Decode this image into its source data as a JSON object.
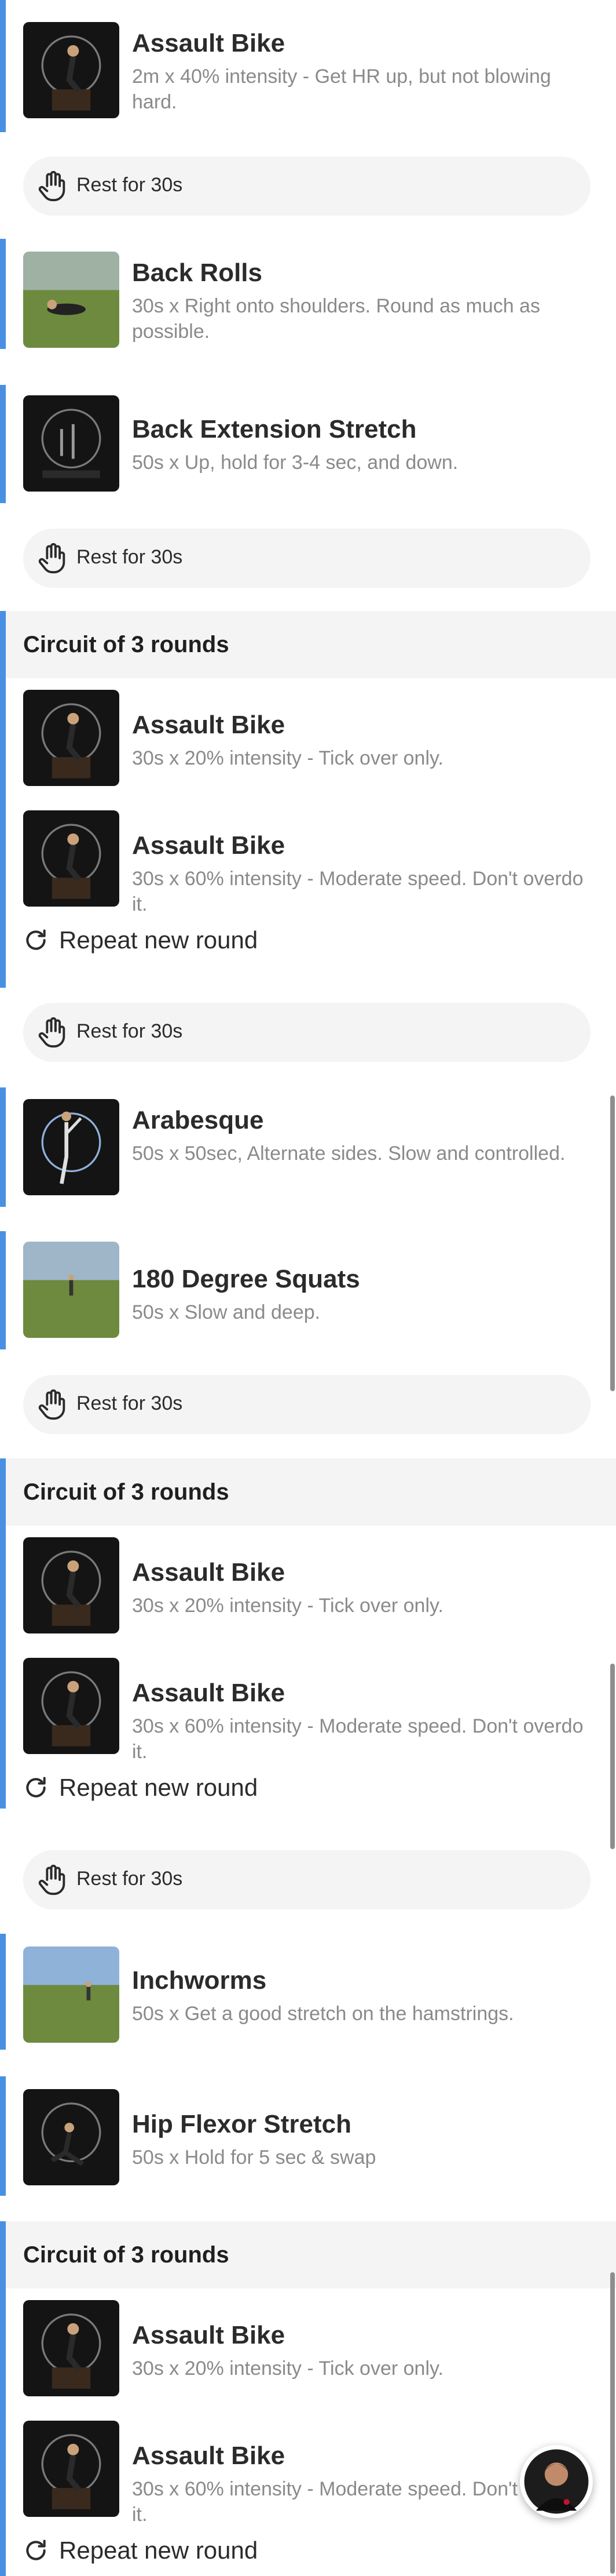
{
  "exercises": [
    {
      "title": "Assault  Bike",
      "desc": "2m x 40% intensity - Get HR up, but not blowing hard."
    },
    {
      "title": "Back Rolls",
      "desc": "30s x Right onto shoulders. Round as much as possible."
    },
    {
      "title": "Back Extension Stretch",
      "desc": "50s x Up, hold for 3-4 sec, and down."
    },
    {
      "title": "Assault  Bike",
      "desc": "30s x 20% intensity - Tick over only."
    },
    {
      "title": "Assault  Bike",
      "desc": "30s x 60% intensity - Moderate speed. Don't overdo it."
    },
    {
      "title": "Arabesque",
      "desc": "50s x 50sec, Alternate sides. Slow and controlled."
    },
    {
      "title": "180 Degree Squats",
      "desc": "50s x Slow and deep."
    },
    {
      "title": "Assault  Bike",
      "desc": "30s x 20% intensity - Tick over only."
    },
    {
      "title": "Assault  Bike",
      "desc": "30s x 60% intensity - Moderate speed. Don't overdo it."
    },
    {
      "title": "Inchworms",
      "desc": "50s x Get a good stretch on the hamstrings."
    },
    {
      "title": "Hip Flexor Stretch",
      "desc": "50s x Hold for 5 sec & swap"
    },
    {
      "title": "Assault  Bike",
      "desc": "30s x 20% intensity - Tick over only."
    },
    {
      "title": "Assault  Bike",
      "desc": "30s x 60% intensity - Moderate speed. Don't overdo it."
    }
  ],
  "rest_label": "Rest for 30s",
  "circuit_label": "Circuit of 3 rounds",
  "repeat_label": "Repeat new round",
  "icons": {
    "rest": "hand-icon",
    "repeat": "refresh-icon",
    "avatar": "coach-avatar"
  },
  "colors": {
    "accent": "#4a90e2",
    "rest_bg": "#f4f4f4",
    "desc_text": "#8a8a8a"
  }
}
